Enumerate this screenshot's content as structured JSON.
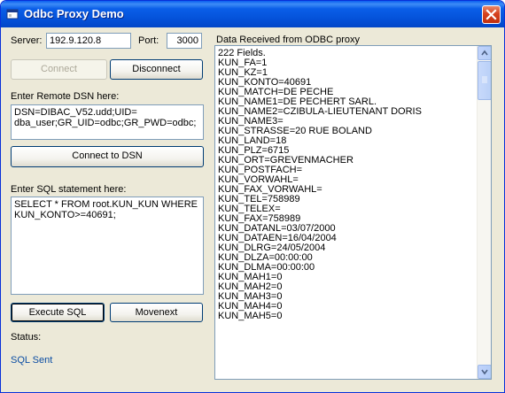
{
  "window": {
    "title": "Odbc Proxy Demo"
  },
  "server": {
    "label": "Server:",
    "value": "192.9.120.8"
  },
  "port": {
    "label": "Port:",
    "value": "3000"
  },
  "buttons": {
    "connect": "Connect",
    "disconnect": "Disconnect",
    "connect_dsn": "Connect to DSN",
    "execute_sql": "Execute SQL",
    "movenext": "Movenext"
  },
  "dsn": {
    "label": "Enter Remote DSN here:",
    "value": "DSN=DIBAC_V52.udd;UID=\ndba_user;GR_UID=odbc;GR_PWD=odbc;"
  },
  "sql": {
    "label": "Enter SQL statement here:",
    "value": "SELECT * FROM root.KUN_KUN WHERE\nKUN_KONTO>=40691;"
  },
  "status": {
    "label": "Status:",
    "value": "SQL Sent"
  },
  "received": {
    "label": "Data Received from ODBC proxy",
    "items": [
      "222 Fields.",
      "KUN_FA=1",
      "KUN_KZ=1",
      "KUN_KONTO=40691",
      "KUN_MATCH=DE PECHE",
      "KUN_NAME1=DE PECHERT SARL.",
      "KUN_NAME2=CZIBULA-LIEUTENANT DORIS",
      "KUN_NAME3=",
      "KUN_STRASSE=20 RUE BOLAND",
      "KUN_LAND=18",
      "KUN_PLZ=6715",
      "KUN_ORT=GREVENMACHER",
      "KUN_POSTFACH=",
      "KUN_VORWAHL=",
      "KUN_FAX_VORWAHL=",
      "KUN_TEL=758989",
      "KUN_TELEX=",
      "KUN_FAX=758989",
      "KUN_DATANL=03/07/2000",
      "KUN_DATAEN=16/04/2004",
      "KUN_DLRG=24/05/2004",
      "KUN_DLZA=00:00:00",
      "KUN_DLMA=00:00:00",
      "KUN_MAH1=0",
      "KUN_MAH2=0",
      "KUN_MAH3=0",
      "KUN_MAH4=0",
      "KUN_MAH5=0"
    ]
  },
  "icons": {
    "app": "odbc-app-icon",
    "close": "close-icon",
    "scroll_up": "scroll-up-icon",
    "scroll_down": "scroll-down-icon"
  },
  "colors": {
    "titlebar": "#0a5ee8",
    "close_button": "#d6421f",
    "window_face": "#ece9d8",
    "status_text": "#0b4da3"
  }
}
